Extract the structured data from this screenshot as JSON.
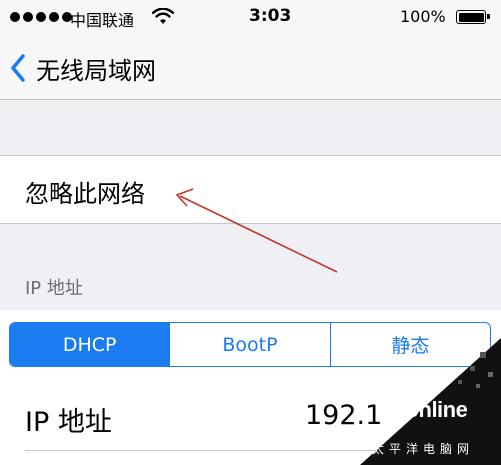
{
  "status_bar": {
    "carrier": "中国联通",
    "time": "3:03",
    "battery": "100%",
    "battery_level": 1.0
  },
  "nav": {
    "back_label": "无线局域网"
  },
  "forget_network": {
    "label": "忽略此网络"
  },
  "annotation": {
    "color": "#c0392b"
  },
  "ip_section": {
    "header": "IP 地址",
    "segments": [
      "DHCP",
      "BootP",
      "静态"
    ],
    "selected_segment": "DHCP"
  },
  "ip_row": {
    "label": "IP 地址",
    "value": "192.1"
  },
  "watermark": {
    "brand": "PConline",
    "sub": "太平洋电脑网"
  },
  "colors": {
    "accent": "#1a7cf0",
    "background": "#efeff4"
  }
}
